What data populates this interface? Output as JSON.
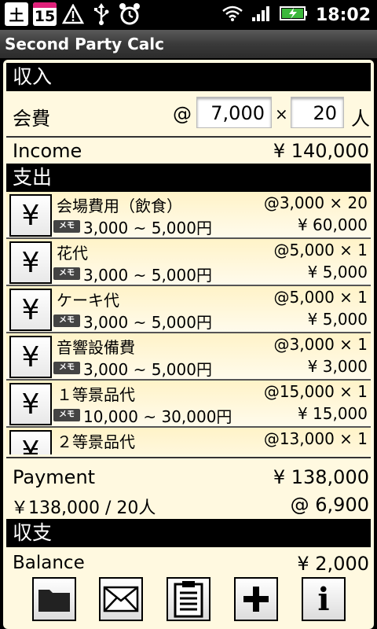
{
  "status_bar": {
    "time": "18:02",
    "calendar_day_1": "土",
    "calendar_day_2": "15"
  },
  "app": {
    "title": "Second Party Calc"
  },
  "income": {
    "header": "収入",
    "fee_label": "会費",
    "at": "@",
    "fee_value": "7,000",
    "times": "×",
    "people_value": "20",
    "people_unit": "人",
    "total_label": "Income",
    "total_value": "¥ 140,000"
  },
  "expense": {
    "header": "支出",
    "yen_symbol": "¥",
    "memo_label": "メモ",
    "items": [
      {
        "name": "会場費用（飲食）",
        "unit": "@3,000 × 20",
        "range": "3,000 ~ 5,000円",
        "total": "¥ 60,000"
      },
      {
        "name": "花代",
        "unit": "@5,000 × 1",
        "range": "3,000 ~ 5,000円",
        "total": "¥ 5,000"
      },
      {
        "name": "ケーキ代",
        "unit": "@5,000 × 1",
        "range": "3,000 ~ 5,000円",
        "total": "¥ 5,000"
      },
      {
        "name": "音響設備費",
        "unit": "@3,000 × 1",
        "range": "3,000 ~ 5,000円",
        "total": "¥ 3,000"
      },
      {
        "name": "１等景品代",
        "unit": "@15,000 × 1",
        "range": "10,000 ~ 30,000円",
        "total": "¥ 15,000"
      },
      {
        "name": "２等景品代",
        "unit": "@13,000 × 1",
        "range": "",
        "total": ""
      }
    ],
    "payment_label": "Payment",
    "payment_value": "¥ 138,000",
    "per_person_label": "￥138,000 / 20人",
    "per_person_value": "@ 6,900"
  },
  "balance": {
    "header": "収支",
    "label": "Balance",
    "value": "¥ 2,000"
  },
  "toolbar": {
    "info_label": "i"
  }
}
